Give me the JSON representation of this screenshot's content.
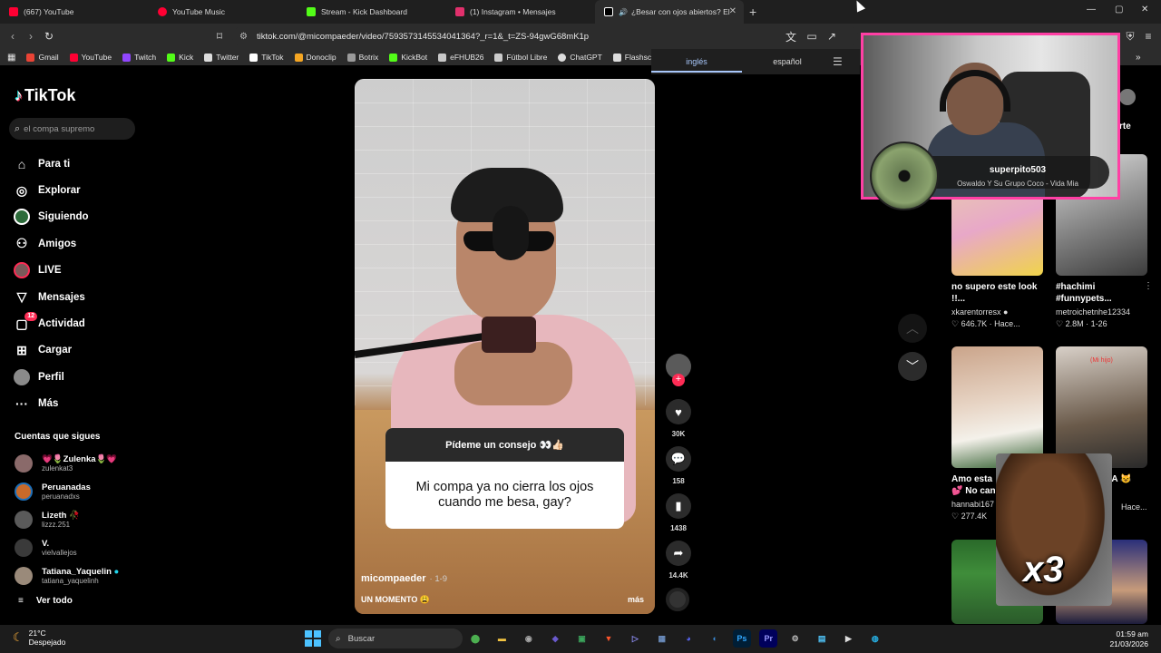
{
  "browser": {
    "tabs": [
      {
        "title": "(667) YouTube",
        "color": "#ff0033"
      },
      {
        "title": "YouTube Music",
        "color": "#ff0033"
      },
      {
        "title": "Stream - Kick Dashboard",
        "color": "#53fc18"
      },
      {
        "title": "(1) Instagram • Mensajes",
        "color": "#e1306c"
      },
      {
        "title": "¿Besar con ojos abiertos? El c",
        "color": "#ffffff",
        "active": true
      }
    ],
    "url": "tiktok.com/@micompaeder/video/7593573145534041364?_r=1&_t=ZS-94gwG68mK1p",
    "bookmarks": [
      {
        "label": "Gmail",
        "color": "#ea4335"
      },
      {
        "label": "YouTube",
        "color": "#ff0033"
      },
      {
        "label": "Twitch",
        "color": "#9146ff"
      },
      {
        "label": "Kick",
        "color": "#53fc18"
      },
      {
        "label": "Twitter",
        "color": "#dddddd"
      },
      {
        "label": "TikTok",
        "color": "#ffffff"
      },
      {
        "label": "Donoclip",
        "color": "#f5a623"
      },
      {
        "label": "Botrix",
        "color": "#9b9b9b"
      },
      {
        "label": "KickBot",
        "color": "#53fc18"
      },
      {
        "label": "eFHUB26",
        "color": "#c9c9c9"
      },
      {
        "label": "Fútbol Libre",
        "color": "#cccccc"
      },
      {
        "label": "ChatGPT",
        "color": "#dddddd"
      },
      {
        "label": "Flashscore",
        "color": "#dddddd"
      }
    ]
  },
  "translate": {
    "lang_from": "inglés",
    "lang_to": "español"
  },
  "tiktok": {
    "logo": "TikTok",
    "search_placeholder": "el compa supremo",
    "nav": [
      {
        "label": "Para ti",
        "icon": "home-icon",
        "glyph": "⌂"
      },
      {
        "label": "Explorar",
        "icon": "compass-icon",
        "glyph": "◎"
      },
      {
        "label": "Siguiendo",
        "icon": "following-avatar-icon",
        "glyph": ""
      },
      {
        "label": "Amigos",
        "icon": "friends-icon",
        "glyph": "👥"
      },
      {
        "label": "LIVE",
        "icon": "live-avatar-icon",
        "glyph": ""
      },
      {
        "label": "Mensajes",
        "icon": "send-icon",
        "glyph": "▽"
      },
      {
        "label": "Actividad",
        "icon": "activity-icon",
        "glyph": "▢",
        "badge": "12"
      },
      {
        "label": "Cargar",
        "icon": "upload-icon",
        "glyph": "⊞"
      },
      {
        "label": "Perfil",
        "icon": "profile-avatar-icon",
        "glyph": ""
      },
      {
        "label": "Más",
        "icon": "more-icon",
        "glyph": "···"
      }
    ],
    "following_title": "Cuentas que sigues",
    "following": [
      {
        "name": "💗🌷Zulenka🌷💗",
        "handle": "zulenkat3",
        "color": "#8a6a6a"
      },
      {
        "name": "Peruanadas",
        "handle": "peruanadxs",
        "color": "#c86a2a"
      },
      {
        "name": "Lizeth 🥀",
        "handle": "lizzz.251",
        "color": "#5a5a5a"
      },
      {
        "name": "V.",
        "handle": "vielvallejos",
        "color": "#3a3a3a"
      },
      {
        "name": "Tatiana_Yaquelin",
        "handle": "tatiana_yaquelinh",
        "color": "#9a8a7a"
      }
    ],
    "see_all": "Ver todo",
    "video": {
      "question_header": "Pídeme un consejo 👀👍🏻",
      "question_body": "Mi compa ya no cierra los ojos cuando me besa, gay?",
      "author": "micompaeder",
      "date": "· 1-9",
      "caption": "UN MOMENTO 😩",
      "more": "más"
    },
    "actions": {
      "likes": "30K",
      "comments": "158",
      "saves": "1438",
      "shares": "14.4K"
    },
    "grid": [
      {
        "title": "no supero este look !!...",
        "user": "xkarentorresx ●",
        "stats": "♡ 646.7K · Hace...",
        "thumb": "linear-gradient(160deg,#e7d7a6,#e8a8c8 55%,#f0d44a)"
      },
      {
        "title": "#hachimi #funnypets...",
        "user": "metroichetnhe12334",
        "stats": "♡ 2.8M · 1-26",
        "thumb": "linear-gradient(160deg,#dcdcdc,#7a7a7a 60%,#3c3c3c)"
      },
      {
        "title": "Amo esta",
        "line2": "💕 No can",
        "user": "hannabi167",
        "stats": "♡ 277.4K",
        "thumb": "linear-gradient(170deg,#caa48a,#e7d4c4 45%,#f4f1ea 70%,#2c5a2a)"
      },
      {
        "title": "TA 😺",
        "user": "",
        "stats": "Hace...",
        "thumb": "linear-gradient(170deg,#d8d0c8,#6a5a4a 60%,#2a2a2a)",
        "overlay": "(Mi hijo)"
      },
      {
        "title": "",
        "user": "",
        "stats": "",
        "thumb": "linear-gradient(180deg,#2a6a2a,#3f8d3a 40%,#2a5a2a)"
      },
      {
        "title": "",
        "user": "",
        "stats": "",
        "thumb": "linear-gradient(180deg,#2a2f7a,#c79b7a 60%,#1c1c3c)"
      }
    ]
  },
  "stream_overlay": {
    "now_playing_user": "superpito503",
    "now_playing_song": "Oswaldo Y Su Grupo Coco - Vida Mia",
    "meme_text": "x3"
  },
  "taskbar": {
    "temp": "21°C",
    "weather": "Despejado",
    "search": "Buscar",
    "time": "01:59 am",
    "date": "21/03/2026",
    "icons": [
      {
        "name": "copilot-icon",
        "glyph": "⬤",
        "color": "#4caf50"
      },
      {
        "name": "file-explorer-icon",
        "glyph": "▬",
        "color": "#f4c542"
      },
      {
        "name": "chrome-icon",
        "glyph": "◉",
        "color": "#888888"
      },
      {
        "name": "app-icon",
        "glyph": "◆",
        "color": "#6a5acd"
      },
      {
        "name": "app-icon-2",
        "glyph": "▣",
        "color": "#3ba55c"
      },
      {
        "name": "brave-icon",
        "glyph": "▼",
        "color": "#fb542b"
      },
      {
        "name": "media-icon",
        "glyph": "▷",
        "color": "#5b5bd6"
      },
      {
        "name": "calculator-icon",
        "glyph": "▦",
        "color": "#6c8ebf"
      },
      {
        "name": "discord-icon",
        "glyph": "◕",
        "color": "#5865f2"
      },
      {
        "name": "steam-icon",
        "glyph": "◐",
        "color": "#1b6aa5"
      },
      {
        "name": "photoshop-icon",
        "glyph": "Ps",
        "color": "#31a8ff"
      },
      {
        "name": "premiere-icon",
        "glyph": "Pr",
        "color": "#9999ff"
      },
      {
        "name": "settings-icon",
        "glyph": "⚙",
        "color": "#bbbbbb"
      },
      {
        "name": "notepad-icon",
        "glyph": "▤",
        "color": "#4fc3f7"
      },
      {
        "name": "player-icon",
        "glyph": "▶",
        "color": "#dddddd"
      },
      {
        "name": "edge-icon",
        "glyph": "◍",
        "color": "#27b3e8"
      }
    ]
  }
}
